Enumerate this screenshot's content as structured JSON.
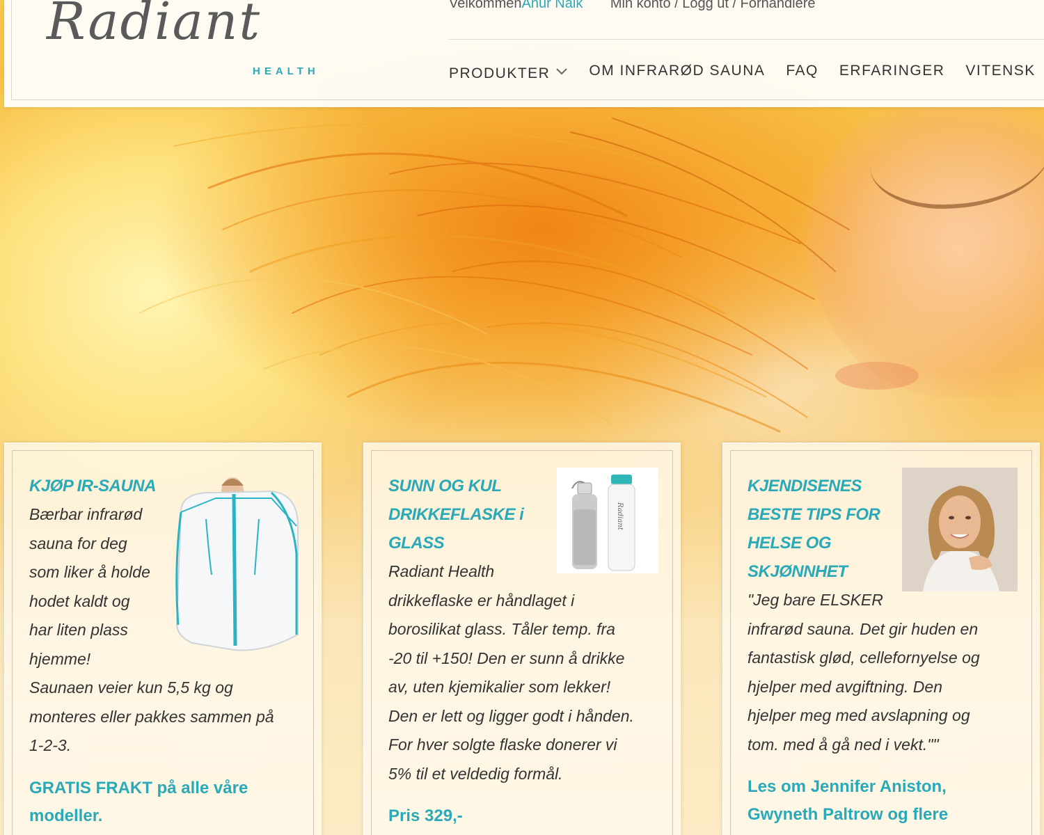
{
  "header": {
    "logo_script": "Radiant",
    "logo_sub": "HEALTH",
    "welcome_label": "Velkommen",
    "username": "Anur Naik",
    "account_links": "Min konto / Logg ut / Forhandlere"
  },
  "nav": {
    "items": [
      {
        "label": "PRODUKTER",
        "has_dropdown": true
      },
      {
        "label": "OM INFRARØD SAUNA"
      },
      {
        "label": "FAQ"
      },
      {
        "label": "ERFARINGER"
      },
      {
        "label": "VITENSK"
      }
    ]
  },
  "cards": [
    {
      "title": "KJØP IR-SAUNA",
      "text_lines": [
        "Bærbar infrarød",
        "sauna for deg",
        "som liker å holde",
        "hodet kaldt og",
        "har liten plass",
        "hjemme!",
        "Saunaen veier kun 5,5 kg og",
        "monteres eller pakkes sammen på",
        "1-2-3."
      ],
      "cta_lines": [
        "GRATIS FRAKT på alle våre",
        "modeller."
      ],
      "image_icon": "portable-sauna"
    },
    {
      "title_lines": [
        "SUNN OG KUL",
        "DRIKKEFLASKE i",
        "GLASS"
      ],
      "text_lines": [
        "Radiant Health",
        "drikkeflaske er håndlaget i",
        "borosilikat glass. Tåler temp. fra",
        "-20 til +150! Den er sunn å drikke",
        "av, uten kjemikalier som lekker!",
        "Den er lett og ligger godt i hånden.",
        "For hver solgte flaske donerer vi",
        "5% til et veldedig formål."
      ],
      "cta_lines": [
        "Pris 329,-"
      ],
      "image_icon": "glass-bottles",
      "bottle_text": "Radiant"
    },
    {
      "title_lines": [
        "KJENDISENES",
        "BESTE TIPS FOR",
        "HELSE OG",
        "SKJØNNHET"
      ],
      "text_lines": [
        "\"Jeg bare ELSKER",
        "infrarød sauna. Det gir huden en",
        "fantastisk glød, cellefornyelse og",
        "hjelper med avgiftning. Den",
        "hjelper meg med avslapning og",
        "tom. med å gå ned i vekt.\"\""
      ],
      "cta_lines": [
        "Les om Jennifer Aniston,",
        "Gwyneth Paltrow og flere"
      ],
      "image_icon": "celebrity-portrait"
    }
  ],
  "colors": {
    "accent": "#2aa9b8",
    "text": "#333333"
  }
}
